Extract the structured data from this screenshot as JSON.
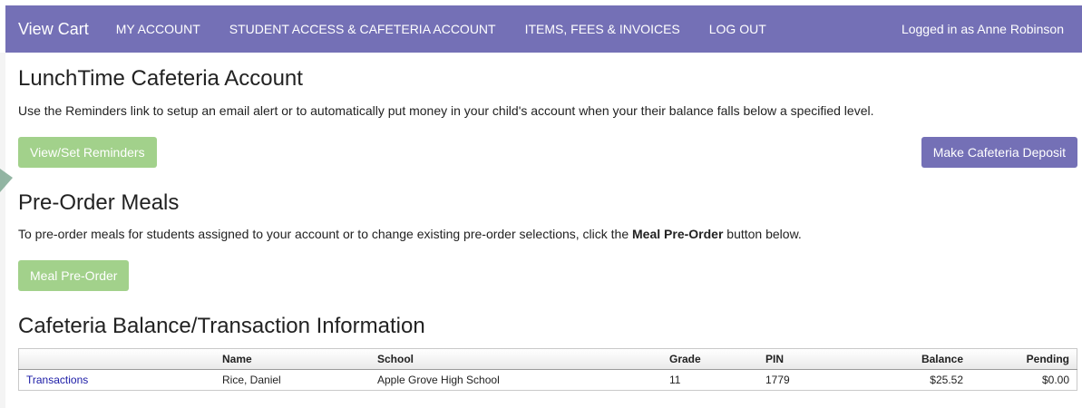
{
  "nav": {
    "brand": "View Cart",
    "links": [
      "MY ACCOUNT",
      "STUDENT ACCESS & CAFETERIA ACCOUNT",
      "ITEMS, FEES & INVOICES",
      "LOG OUT"
    ],
    "user": "Logged in as Anne Robinson",
    "background": "#7470b6"
  },
  "cafeteria": {
    "title": "LunchTime Cafeteria Account",
    "description": "Use the Reminders link to setup an email alert or to automatically put money in your child's account when your their balance falls below a specified level.",
    "reminders_button": "View/Set Reminders",
    "deposit_button": "Make Cafeteria Deposit"
  },
  "preorder": {
    "title": "Pre-Order Meals",
    "description_before": "To pre-order meals for students assigned to your account or to change existing pre-order selections, click the ",
    "description_bold": "Meal Pre-Order",
    "description_after": " button below.",
    "button": "Meal Pre-Order"
  },
  "balance": {
    "title": "Cafeteria Balance/Transaction Information",
    "columns": [
      "",
      "Name",
      "School",
      "Grade",
      "PIN",
      "Balance",
      "Pending"
    ],
    "rows": [
      {
        "link": "Transactions",
        "name": "Rice, Daniel",
        "school": "Apple Grove High School",
        "grade": "11",
        "pin": "1779",
        "balance": "$25.52",
        "pending": "$0.00"
      }
    ]
  },
  "colors": {
    "accent_purple": "#7470b6",
    "button_green": "#a2d18b",
    "link_blue": "#1a1aa6"
  }
}
